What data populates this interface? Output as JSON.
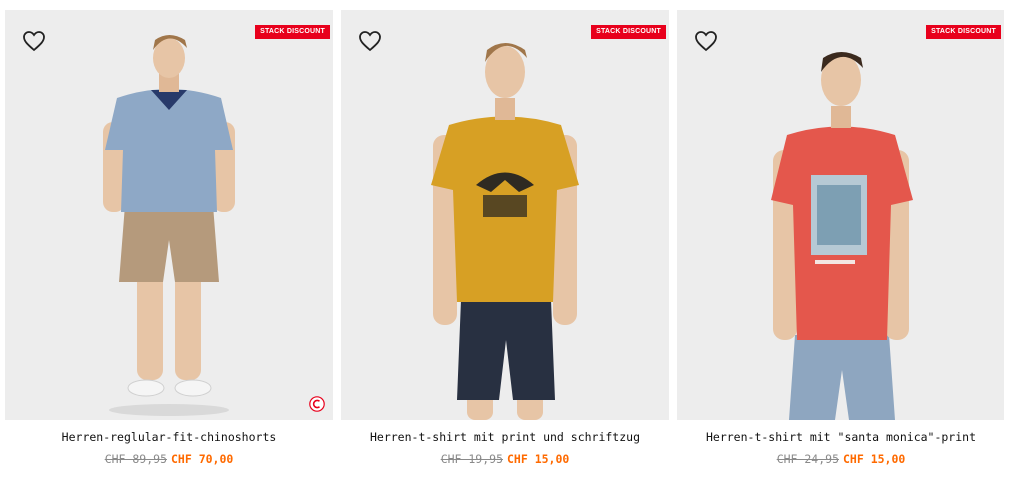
{
  "products": [
    {
      "badge": "STACK DISCOUNT",
      "name": "Herren-reglular-fit-chinoshorts",
      "old_price": "CHF 89,95",
      "new_price": "CHF 70,00",
      "shirt_color": "#8ea8c6",
      "bottom_color": "#b59a7c",
      "has_stack_icon": true
    },
    {
      "badge": "STACK DISCOUNT",
      "name": "Herren-t-shirt mit print und schriftzug",
      "old_price": "CHF 19,95",
      "new_price": "CHF 15,00",
      "shirt_color": "#d7a024",
      "bottom_color": "#283041",
      "has_stack_icon": false
    },
    {
      "badge": "STACK DISCOUNT",
      "name": "Herren-t-shirt mit \"santa monica\"-print",
      "old_price": "CHF 24,95",
      "new_price": "CHF 15,00",
      "shirt_color": "#e4574c",
      "bottom_color": "#8ea6c0",
      "has_stack_icon": false
    }
  ],
  "colors": {
    "badge_bg": "#e8001c",
    "sale_price": "#ff6a00",
    "old_price": "#8a8a8a",
    "photo_bg": "#ededed"
  },
  "icons": {
    "wishlist": "heart-outline-icon",
    "stack": "stack-discount-icon"
  }
}
